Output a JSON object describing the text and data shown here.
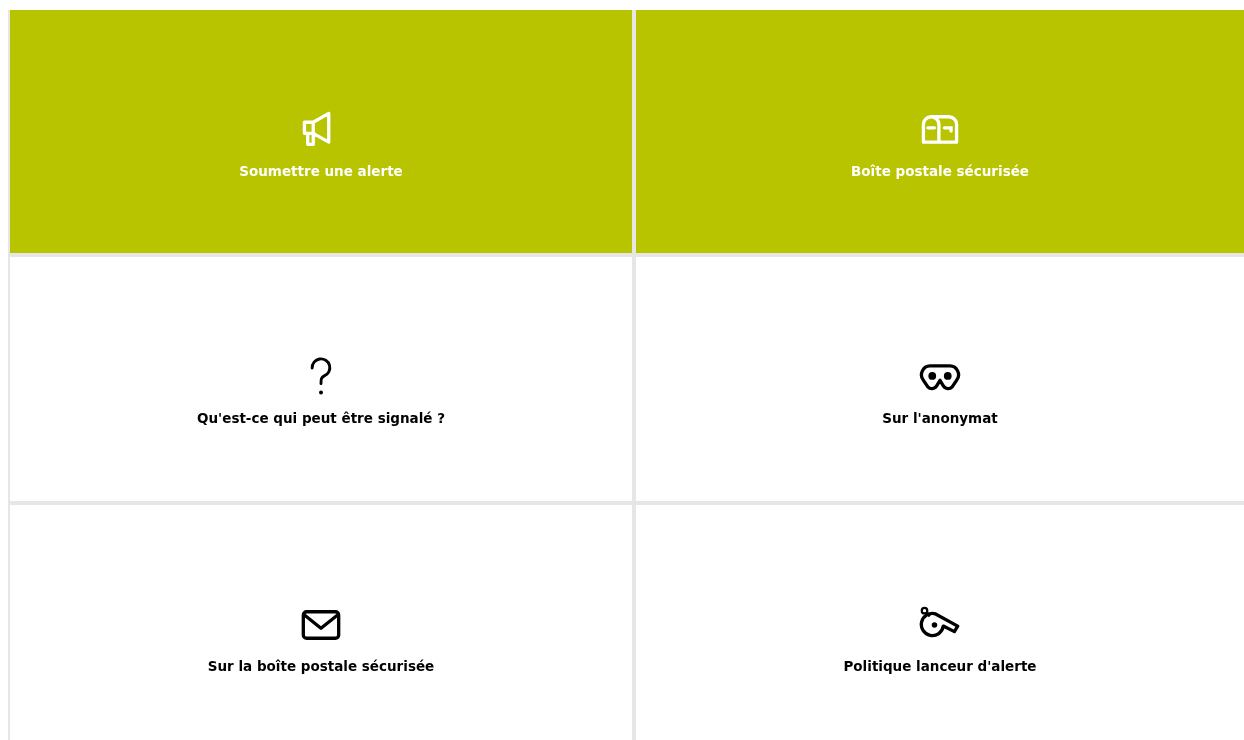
{
  "tiles": [
    {
      "label": "Soumettre une alerte",
      "kind": "primary"
    },
    {
      "label": "Boîte postale sécurisée",
      "kind": "primary"
    },
    {
      "label": "Qu'est-ce qui peut être signalé ?",
      "kind": "plain"
    },
    {
      "label": "Sur l'anonymat",
      "kind": "plain"
    },
    {
      "label": "Sur la boîte postale sécurisée",
      "kind": "plain"
    },
    {
      "label": "Politique lanceur d'alerte",
      "kind": "plain"
    }
  ]
}
